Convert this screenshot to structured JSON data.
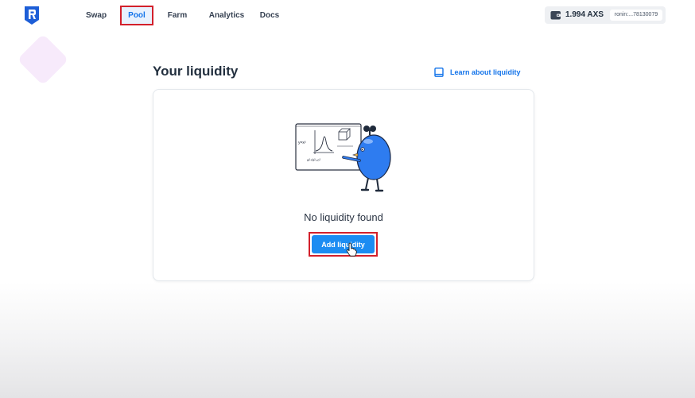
{
  "nav": {
    "items": [
      {
        "label": "Swap",
        "active": false
      },
      {
        "label": "Pool",
        "active": true
      },
      {
        "label": "Farm",
        "active": false
      },
      {
        "label": "Analytics",
        "active": false
      },
      {
        "label": "Docs",
        "active": false
      }
    ]
  },
  "wallet": {
    "balance": "1.994 AXS",
    "address": "ronin:...78130079",
    "icon": "wallet-icon"
  },
  "page": {
    "title": "Your liquidity",
    "learn_link": "Learn about liquidity",
    "learn_icon": "book-icon"
  },
  "empty_state": {
    "message": "No liquidity found",
    "illustration": "mascot-at-whiteboard"
  },
  "actions": {
    "add_liquidity": "Add liquidity"
  },
  "colors": {
    "accent": "#1273ea",
    "button": "#1c8cf2",
    "highlight_border": "#d3202b",
    "brand": "#1d5ed7"
  }
}
